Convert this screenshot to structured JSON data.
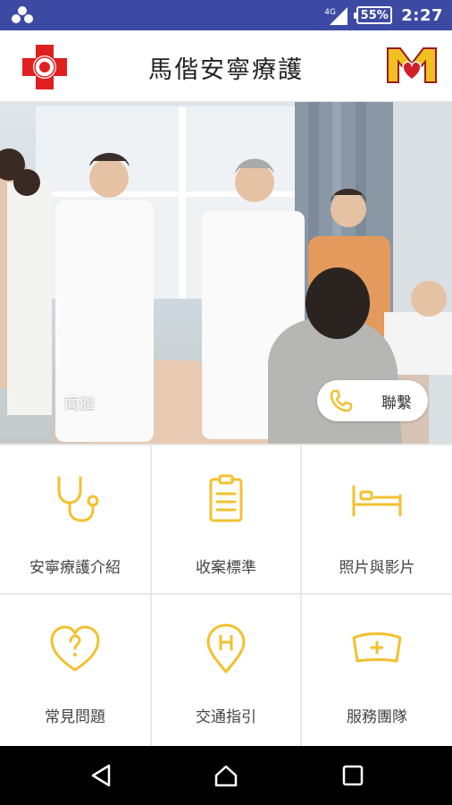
{
  "status_bar": {
    "network": "4G",
    "battery": "55%",
    "time": "2:27"
  },
  "header": {
    "title": "馬偕安寧療護"
  },
  "hero": {
    "label": "簡體",
    "contact_label": "聯繫"
  },
  "menu": {
    "items": [
      {
        "label": "安寧療護介紹",
        "icon": "stethoscope-icon"
      },
      {
        "label": "收案標準",
        "icon": "clipboard-icon"
      },
      {
        "label": "照片與影片",
        "icon": "bed-icon"
      },
      {
        "label": "常見問題",
        "icon": "heart-question-icon"
      },
      {
        "label": "交通指引",
        "icon": "map-pin-h-icon"
      },
      {
        "label": "服務團隊",
        "icon": "nurse-cap-icon"
      }
    ]
  },
  "colors": {
    "status_bar": "#3d4aa3",
    "accent_yellow": "#f2c12e",
    "logo_red": "#e0201e"
  }
}
